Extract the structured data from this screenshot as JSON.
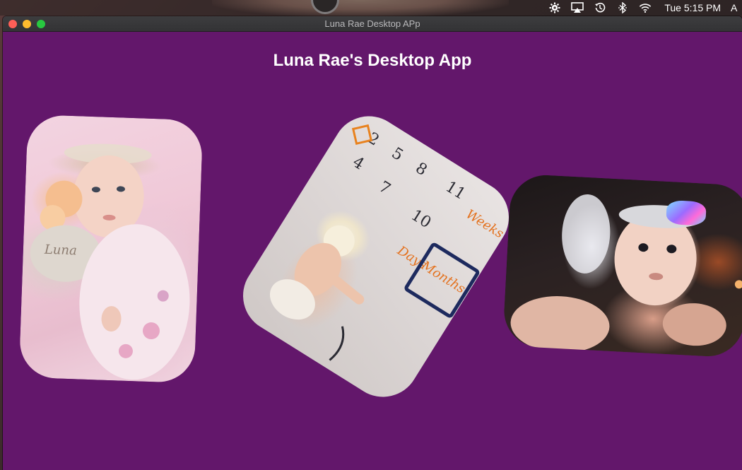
{
  "menubar": {
    "clock": "Tue 5:15 PM",
    "user_initial": "A",
    "icons": [
      "bluetooth-gear-icon",
      "airplay-icon",
      "time-machine-icon",
      "bluetooth-icon",
      "wifi-icon"
    ]
  },
  "window": {
    "title": "Luna Rae Desktop APp",
    "controls": [
      "close",
      "minimize",
      "zoom"
    ]
  },
  "app": {
    "heading": "Luna Rae's Desktop App",
    "background_color": "#63176b"
  },
  "photos": [
    {
      "subject": "baby-with-flower-headband-on-pink-blanket"
    },
    {
      "subject": "baby-on-milestone-calendar-blanket",
      "printed_words": [
        "Days",
        "Months",
        "Weeks"
      ],
      "printed_numbers": [
        "2",
        "5",
        "8",
        "11",
        "4",
        "7",
        "10"
      ]
    },
    {
      "subject": "baby-with-iridescent-bow-and-fairy-wings"
    }
  ]
}
